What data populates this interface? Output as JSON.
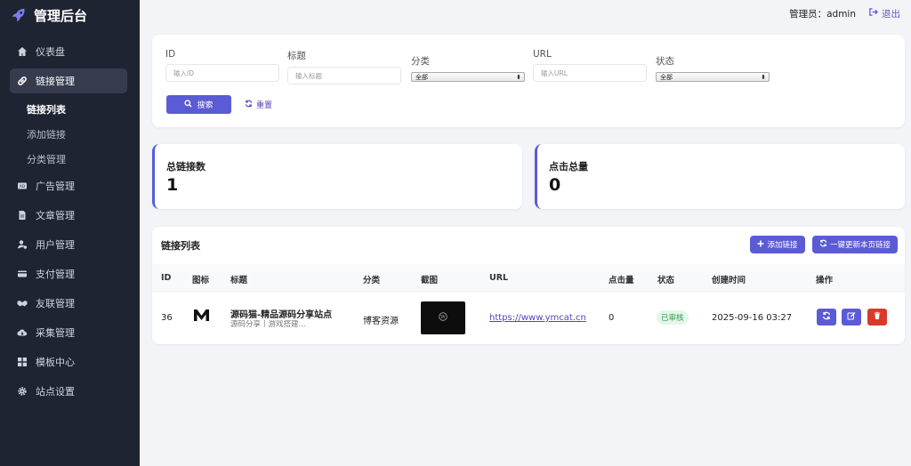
{
  "app": {
    "title": "管理后台"
  },
  "sidebar": {
    "items": [
      {
        "label": "仪表盘",
        "icon": "home-icon"
      },
      {
        "label": "链接管理",
        "icon": "link-icon",
        "active": true,
        "children": [
          {
            "label": "链接列表",
            "active": true
          },
          {
            "label": "添加链接"
          },
          {
            "label": "分类管理"
          }
        ]
      },
      {
        "label": "广告管理",
        "icon": "ad-icon"
      },
      {
        "label": "文章管理",
        "icon": "file-icon"
      },
      {
        "label": "用户管理",
        "icon": "user-gear-icon"
      },
      {
        "label": "支付管理",
        "icon": "card-icon"
      },
      {
        "label": "友联管理",
        "icon": "handshake-icon"
      },
      {
        "label": "采集管理",
        "icon": "cloud-download-icon"
      },
      {
        "label": "模板中心",
        "icon": "grid-icon"
      },
      {
        "label": "站点设置",
        "icon": "gear-icon"
      }
    ]
  },
  "topbar": {
    "admin_label": "管理员：admin",
    "logout_label": "退出"
  },
  "filter": {
    "id": {
      "label": "ID",
      "placeholder": "输入ID"
    },
    "title": {
      "label": "标题",
      "placeholder": "输入标题"
    },
    "category": {
      "label": "分类",
      "value": "全部"
    },
    "url": {
      "label": "URL",
      "placeholder": "输入URL"
    },
    "status": {
      "label": "状态",
      "value": "全部"
    },
    "search_label": "搜索",
    "reset_label": "重置"
  },
  "stats": {
    "total_links": {
      "label": "总链接数",
      "value": "1"
    },
    "total_clicks": {
      "label": "点击总量",
      "value": "0"
    }
  },
  "table": {
    "title": "链接列表",
    "add_label": "添加链接",
    "update_label": "一键更新本页链接",
    "columns": [
      "ID",
      "图标",
      "标题",
      "分类",
      "截图",
      "URL",
      "点击量",
      "状态",
      "创建时间",
      "操作"
    ],
    "rows": [
      {
        "id": "36",
        "title": "源码猫-精品源码分享站点",
        "desc": "源码分享丨游戏搭建...",
        "category": "博客资源",
        "url": "https://www.ymcat.cn",
        "clicks": "0",
        "status": "已审核",
        "created": "2025-09-16 03:27"
      }
    ]
  },
  "colors": {
    "accent": "#5b5bd6",
    "sidebar_bg": "#1f2433",
    "danger": "#d93a2b",
    "success": "#2e9c4b"
  }
}
